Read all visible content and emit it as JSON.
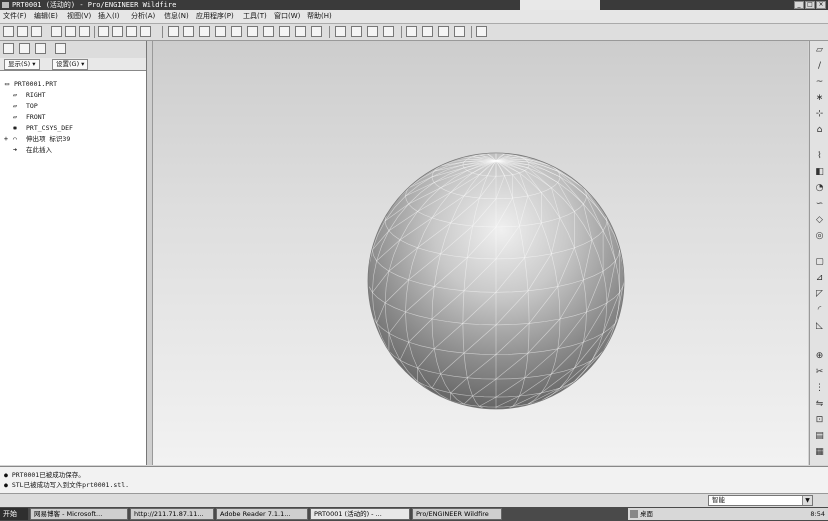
{
  "window": {
    "title": "PRT0001 (活动的) - Pro/ENGINEER Wildfire",
    "controls": [
      "minimize",
      "maximize",
      "close"
    ]
  },
  "menu": {
    "items": [
      "文件(F)",
      "编辑(E)",
      "视图(V)",
      "插入(I)",
      "分析(A)",
      "信息(N)",
      "应用程序(P)",
      "工具(T)",
      "窗口(W)",
      "帮助(H)"
    ]
  },
  "left_panel": {
    "show_dropdown": "显示(S) ▾",
    "settings_dropdown": "设置(G) ▾",
    "tree": [
      {
        "label": "PRT0001.PRT",
        "icon": "part-icon"
      },
      {
        "label": "RIGHT",
        "icon": "datum-plane-icon"
      },
      {
        "label": "TOP",
        "icon": "datum-plane-icon"
      },
      {
        "label": "FRONT",
        "icon": "datum-plane-icon"
      },
      {
        "label": "PRT_CSYS_DEF",
        "icon": "coordinate-system-icon"
      },
      {
        "label": "伸出项 标识39",
        "icon": "protrusion-icon"
      },
      {
        "label": "在此插入",
        "icon": "insert-arrow-icon"
      }
    ]
  },
  "messages": [
    "● PRT0001已被成功保存。",
    "● STL已被成功写入到文件prt0001.stl."
  ],
  "status": {
    "filter_value": "智能"
  },
  "taskbar": {
    "start_label": "开始",
    "tasks": [
      "网易博客 - Microsoft...",
      "http://211.71.87.11...",
      "Adobe Reader 7.1.1...",
      "PRT0001 (活动的) - ...",
      "Pro/ENGINEER Wildfire"
    ],
    "desktop_label": "桌面",
    "clock": "8:54"
  },
  "colors": {
    "titlebar": "#3a3a3a",
    "viewport_top": "#cdcdcd",
    "viewport_bottom": "#f2f2f2",
    "sphere_light": "#f0f0f0",
    "sphere_dark": "#5a5a5a"
  }
}
